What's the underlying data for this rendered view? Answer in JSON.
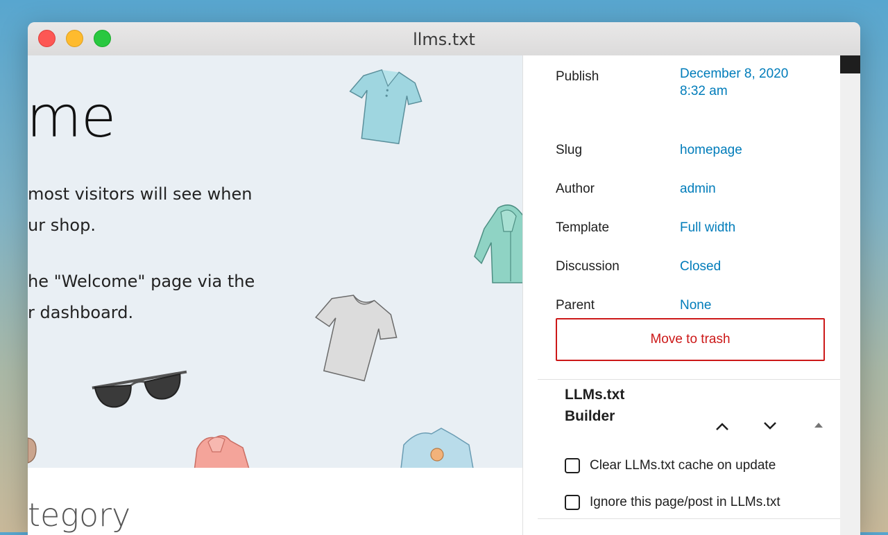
{
  "window": {
    "title": "llms.txt"
  },
  "canvas": {
    "heading": "me",
    "paragraph_lines": [
      "most visitors will see when",
      "ur shop.",
      "he \"Welcome\" page via the",
      "r dashboard."
    ],
    "category_heading": "tegory"
  },
  "sidebar": {
    "rows": [
      {
        "label": "Publish",
        "value_lines": [
          "December 8, 2020",
          "8:32 am"
        ]
      },
      {
        "label": "Slug",
        "value": "homepage"
      },
      {
        "label": "Author",
        "value": "admin"
      },
      {
        "label": "Template",
        "value": "Full width"
      },
      {
        "label": "Discussion",
        "value": "Closed"
      },
      {
        "label": "Parent",
        "value": "None"
      }
    ],
    "trash_label": "Move to trash",
    "panel": {
      "title_lines": [
        "LLMs.txt",
        "Builder"
      ],
      "controls": [
        "chevron-up-icon",
        "chevron-down-icon",
        "caret-up-icon"
      ],
      "checkboxes": [
        {
          "label": "Clear LLMs.txt cache on update",
          "checked": false
        },
        {
          "label": "Ignore this page/post in LLMs.txt",
          "checked": false
        }
      ]
    }
  },
  "colors": {
    "link": "#007cba",
    "danger": "#cc1818",
    "hero_bg": "#e9eff4"
  }
}
